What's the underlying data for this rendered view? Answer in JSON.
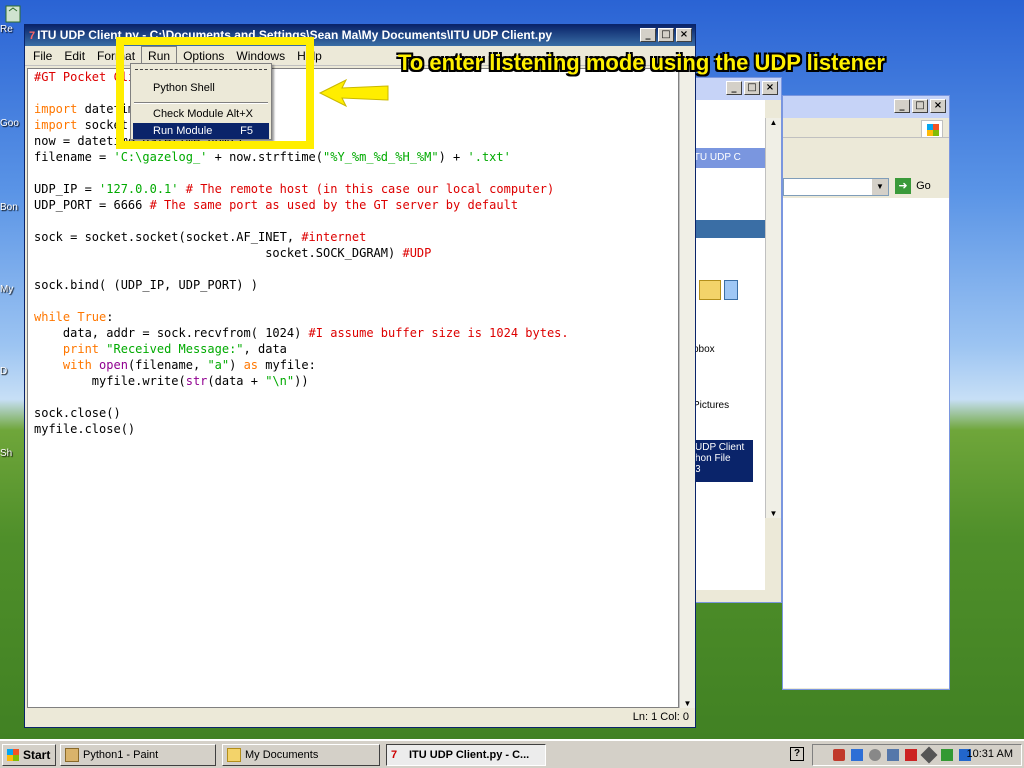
{
  "desktop": {
    "icons": [
      {
        "label": "Re"
      },
      {
        "label": "Goo"
      },
      {
        "label": "Bon"
      },
      {
        "label": "My"
      },
      {
        "label": "D"
      },
      {
        "label": "Sh"
      }
    ]
  },
  "explorer_back": {
    "address_go": "Go",
    "labels": [
      "ITU UDP C",
      "pbox",
      "Pictures",
      "UDP Client",
      "hon File",
      "3"
    ]
  },
  "idle": {
    "title": "ITU UDP Client.py - C:\\Documents and Settings\\Sean Ma\\My Documents\\ITU UDP Client.py",
    "menu": [
      "File",
      "Edit",
      "Format",
      "Run",
      "Options",
      "Windows",
      "Help"
    ],
    "status": "Ln: 1 Col: 0",
    "code_lines": [
      "#GT Pocket Client",
      "",
      "import datetime",
      "import socket",
      "now = datetime.datetime.now()",
      "filename = 'C:\\gazelog_' + now.strftime(\"%Y_%m_%d_%H_%M\") + '.txt'",
      "",
      "UDP_IP = '127.0.0.1' # The remote host (in this case our local computer)",
      "UDP_PORT = 6666 # The same port as used by the GT server by default",
      "",
      "sock = socket.socket(socket.AF_INET, #internet",
      "                                socket.SOCK_DGRAM) #UDP",
      "",
      "sock.bind( (UDP_IP, UDP_PORT) )",
      "",
      "while True:",
      "    data, addr = sock.recvfrom( 1024) #I assume buffer size is 1024 bytes.",
      "    print \"Received Message:\", data",
      "    with open(filename, \"a\") as myfile:",
      "        myfile.write(str(data + \"\\n\"))",
      "",
      "sock.close()",
      "myfile.close()"
    ]
  },
  "run_menu": {
    "items": [
      {
        "label": "Python Shell",
        "shortcut": ""
      },
      {
        "label": "Check Module",
        "shortcut": "Alt+X"
      },
      {
        "label": "Run Module",
        "shortcut": "F5"
      }
    ]
  },
  "annotation": {
    "text": "To enter listening mode using the UDP listener",
    "color": "#ffee00"
  },
  "taskbar": {
    "start": "Start",
    "tasks": [
      {
        "label": "Python1 - Paint"
      },
      {
        "label": "My Documents"
      },
      {
        "label": "ITU UDP Client.py - C..."
      }
    ],
    "clock": "10:31 AM"
  }
}
